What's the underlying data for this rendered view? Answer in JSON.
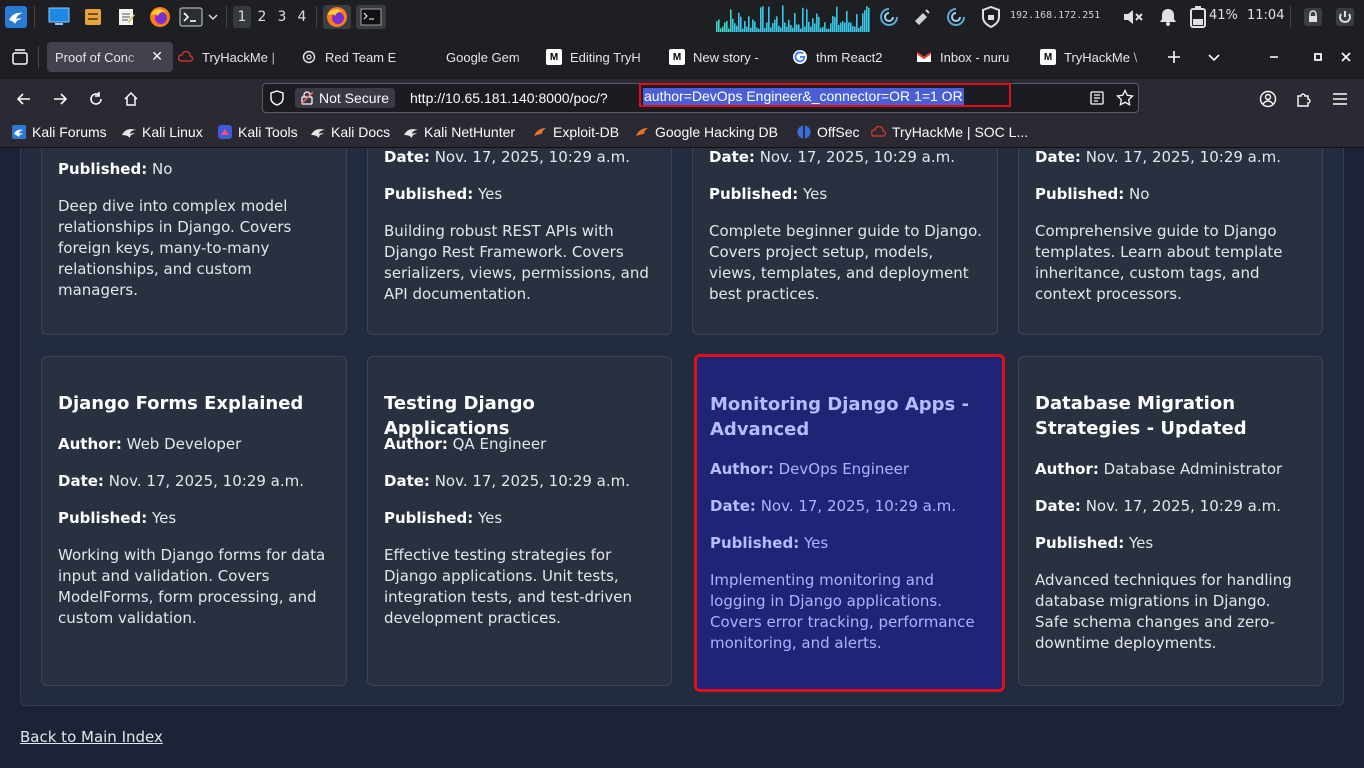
{
  "taskbar": {
    "workspaces": [
      "1",
      "2",
      "3",
      "4"
    ],
    "active_workspace": "1",
    "ip": "192.168.172.251",
    "battery": "41%",
    "clock": "11:04",
    "colors": {
      "graph": "#39c7e8",
      "bg": "#1d1f22"
    }
  },
  "tabs": [
    {
      "label": "Proof of Conc",
      "icon": "none",
      "active": true
    },
    {
      "label": "TryHackMe |",
      "icon": "tryhackme-icon"
    },
    {
      "label": "Red Team E",
      "icon": "openai-icon"
    },
    {
      "label": "Google Gem",
      "icon": "none"
    },
    {
      "label": "Editing TryH",
      "icon": "medium-icon"
    },
    {
      "label": "New story -",
      "icon": "medium-icon"
    },
    {
      "label": "thm React2",
      "icon": "google-icon"
    },
    {
      "label": "Inbox - nuru",
      "icon": "gmail-icon"
    },
    {
      "label": "TryHackMe \\",
      "icon": "medium-icon"
    }
  ],
  "nav": {
    "security_label": "Not Secure",
    "url_prefix": "http://10.65.181.140:8000/poc/?",
    "url_selected": "author=DevOps Engineer&_connector=OR 1=1 OR"
  },
  "bookmarks": [
    {
      "label": "Kali Forums",
      "icon": "kali-icon"
    },
    {
      "label": "Kali Linux",
      "icon": "kali-dragon-icon"
    },
    {
      "label": "Kali Tools",
      "icon": "kali-tools-icon"
    },
    {
      "label": "Kali Docs",
      "icon": "kali-dragon-icon"
    },
    {
      "label": "Kali NetHunter",
      "icon": "kali-dragon-icon"
    },
    {
      "label": "Exploit-DB",
      "icon": "exploitdb-icon"
    },
    {
      "label": "Google Hacking DB",
      "icon": "exploitdb-icon"
    },
    {
      "label": "OffSec",
      "icon": "offsec-icon"
    },
    {
      "label": "TryHackMe | SOC L...",
      "icon": "tryhackme-icon"
    }
  ],
  "page": {
    "labels": {
      "author": "Author:",
      "date": "Date:",
      "published": "Published:"
    },
    "top_row": [
      {
        "published": "No",
        "description": "Deep dive into complex model relationships in Django. Covers foreign keys, many-to-many relationships, and custom managers."
      },
      {
        "date": "Nov. 17, 2025, 10:29 a.m.",
        "published": "Yes",
        "description": "Building robust REST APIs with Django Rest Framework. Covers serializers, views, permissions, and API documentation."
      },
      {
        "date": "Nov. 17, 2025, 10:29 a.m.",
        "published": "Yes",
        "description": "Complete beginner guide to Django. Covers project setup, models, views, templates, and deployment best practices."
      },
      {
        "date": "Nov. 17, 2025, 10:29 a.m.",
        "published": "No",
        "description": "Comprehensive guide to Django templates. Learn about template inheritance, custom tags, and context processors."
      }
    ],
    "bottom_row": [
      {
        "title": "Django Forms Explained",
        "author": "Web Developer",
        "date": "Nov. 17, 2025, 10:29 a.m.",
        "published": "Yes",
        "description": "Working with Django forms for data input and validation. Covers ModelForms, form processing, and custom validation."
      },
      {
        "title": "Testing Django Applications",
        "author": "QA Engineer",
        "date": "Nov. 17, 2025, 10:29 a.m.",
        "published": "Yes",
        "description": "Effective testing strategies for Django applications. Unit tests, integration tests, and test-driven development practices."
      },
      {
        "title": "Monitoring Django Apps - Advanced",
        "author": "DevOps Engineer",
        "date": "Nov. 17, 2025, 10:29 a.m.",
        "published": "Yes",
        "description": "Implementing monitoring and logging in Django applications. Covers error tracking, performance monitoring, and alerts.",
        "highlighted": true
      },
      {
        "title": "Database Migration Strategies - Updated",
        "author": "Database Administrator",
        "date": "Nov. 17, 2025, 10:29 a.m.",
        "published": "Yes",
        "description": "Advanced techniques for handling database migrations in Django. Safe schema changes and zero-downtime deployments."
      }
    ],
    "back_link": "Back to Main Index",
    "colors": {
      "highlight_border": "#e0101b",
      "highlight_bg": "#1e2576",
      "card_bg": "#29303f",
      "page_bg": "#1c2336"
    }
  }
}
